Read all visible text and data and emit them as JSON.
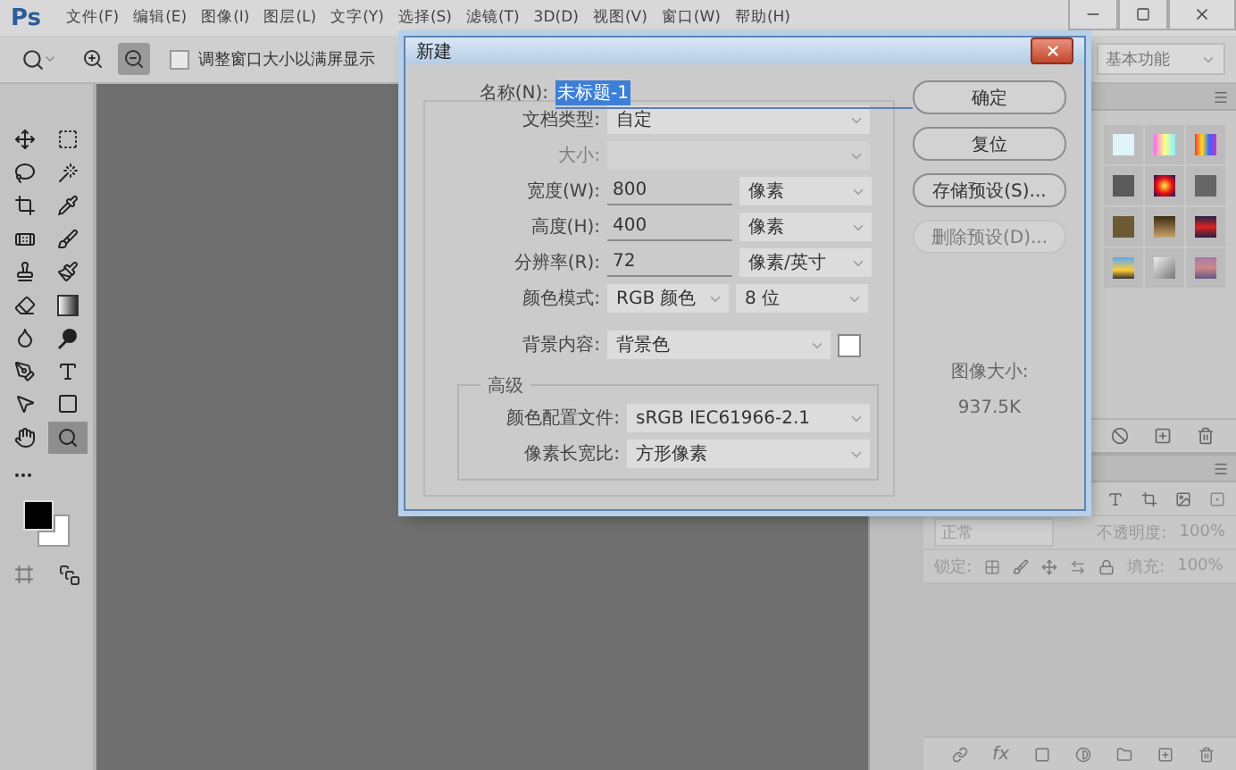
{
  "menu": {
    "logo": "Ps",
    "items": [
      "文件(F)",
      "编辑(E)",
      "图像(I)",
      "图层(L)",
      "文字(Y)",
      "选择(S)",
      "滤镜(T)",
      "3D(D)",
      "视图(V)",
      "窗口(W)",
      "帮助(H)"
    ]
  },
  "options_bar": {
    "zoom_modes": [
      {
        "kind": "zoom_in",
        "selected": false
      },
      {
        "kind": "zoom_out",
        "selected": true
      }
    ],
    "checkboxes": [
      {
        "label": "调整窗口大小以满屏显示",
        "checked": false
      }
    ],
    "workspace": "基本功能"
  },
  "tools": [
    {
      "kind": "move",
      "selected": false
    },
    {
      "kind": "marquee",
      "selected": false
    },
    {
      "kind": "lasso",
      "selected": false
    },
    {
      "kind": "magic_wand",
      "selected": false
    },
    {
      "kind": "crop",
      "selected": false
    },
    {
      "kind": "eyedropper",
      "selected": false
    },
    {
      "kind": "healing",
      "selected": false
    },
    {
      "kind": "brush",
      "selected": false
    },
    {
      "kind": "stamp",
      "selected": false
    },
    {
      "kind": "history_brush",
      "selected": false
    },
    {
      "kind": "eraser",
      "selected": false
    },
    {
      "kind": "gradient",
      "selected": false
    },
    {
      "kind": "blur",
      "selected": false
    },
    {
      "kind": "dodge",
      "selected": false
    },
    {
      "kind": "pen",
      "selected": false
    },
    {
      "kind": "type",
      "selected": false
    },
    {
      "kind": "path_select",
      "selected": false
    },
    {
      "kind": "rectangle",
      "selected": false
    },
    {
      "kind": "hand",
      "selected": false
    },
    {
      "kind": "zoom",
      "selected": true
    }
  ],
  "dialog": {
    "title": "新建",
    "name": {
      "label": "名称(N):",
      "value": "未标题-1",
      "value_selected": true
    },
    "fields": [
      {
        "kind": "select",
        "label": "文档类型:",
        "value": "自定",
        "disabled": false
      },
      {
        "kind": "select",
        "label": "大小:",
        "disabled": true
      },
      {
        "kind": "input_unit",
        "label": "宽度(W):",
        "value": "800",
        "unit": "像素",
        "disabled": false
      },
      {
        "kind": "input_unit",
        "label": "高度(H):",
        "value": "400",
        "unit": "像素",
        "disabled": false
      },
      {
        "kind": "input_unit",
        "label": "分辨率(R):",
        "value": "72",
        "unit": "像素/英寸",
        "disabled": false
      },
      {
        "kind": "select_pair",
        "label": "颜色模式:",
        "value": "RGB 颜色",
        "unit": "8 位",
        "disabled": false
      },
      {
        "kind": "select_swatch",
        "label": "背景内容:",
        "value": "背景色",
        "color": "#ffffff",
        "disabled": false
      }
    ],
    "advanced": {
      "title": "高级",
      "fields": [
        {
          "kind": "select",
          "label": "颜色配置文件:",
          "value": "sRGB IEC61966-2.1",
          "disabled": false
        },
        {
          "kind": "select",
          "label": "像素长宽比:",
          "value": "方形像素",
          "disabled": false
        }
      ]
    },
    "buttons": [
      {
        "label": "确定",
        "disabled": false
      },
      {
        "label": "复位",
        "disabled": false
      },
      {
        "label": "存储预设(S)...",
        "disabled": false
      },
      {
        "label": "删除预设(D)...",
        "disabled": true
      }
    ],
    "image_size": {
      "label": "图像大小:",
      "value": "937.5K"
    }
  },
  "layers_panel": {
    "blend_mode": "正常",
    "opacity_label": "不透明度:",
    "opacity": "100%",
    "lock_label": "锁定:",
    "fill_label": "填充:",
    "fill": "100%",
    "effects_button": "fx"
  }
}
